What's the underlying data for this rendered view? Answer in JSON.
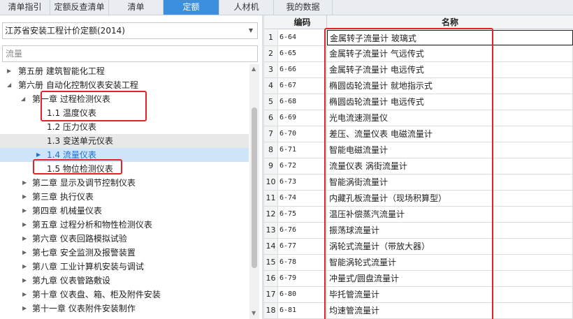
{
  "tabs": [
    {
      "label": "清单指引",
      "active": false
    },
    {
      "label": "定额反查清单",
      "active": false
    },
    {
      "label": "清单",
      "active": false
    },
    {
      "label": "定额",
      "active": true
    },
    {
      "label": "人材机",
      "active": false
    },
    {
      "label": "我的数据",
      "active": false
    }
  ],
  "left": {
    "quota_library": "江苏省安装工程计价定额(2014)",
    "search_placeholder": "流量",
    "tree": [
      {
        "label": "第五册 建筑智能化工程",
        "state": "collapsed"
      },
      {
        "label": "第六册 自动化控制仪表安装工程",
        "state": "expanded"
      },
      {
        "label": "第一章 过程检测仪表",
        "state": "expanded"
      },
      {
        "label": "1.1 温度仪表",
        "state": "leaf"
      },
      {
        "label": "1.2 压力仪表",
        "state": "leaf"
      },
      {
        "label": "1.3 变送单元仪表",
        "state": "leaf"
      },
      {
        "label": "1.4 流量仪表",
        "state": "selected"
      },
      {
        "label": "1.5 物位检测仪表",
        "state": "leaf"
      },
      {
        "label": "第二章 显示及调节控制仪表",
        "state": "collapsed"
      },
      {
        "label": "第三章 执行仪表",
        "state": "collapsed"
      },
      {
        "label": "第四章 机械量仪表",
        "state": "collapsed"
      },
      {
        "label": "第五章 过程分析和物性检测仪表",
        "state": "collapsed"
      },
      {
        "label": "第六章 仪表回路模拟试验",
        "state": "collapsed"
      },
      {
        "label": "第七章 安全监测及报警装置",
        "state": "collapsed"
      },
      {
        "label": "第八章 工业计算机安装与调试",
        "state": "collapsed"
      },
      {
        "label": "第九章 仪表管路敷设",
        "state": "collapsed"
      },
      {
        "label": "第十章 仪表盘、箱、柜及附件安装",
        "state": "collapsed"
      },
      {
        "label": "第十一章 仪表附件安装制作",
        "state": "collapsed"
      }
    ]
  },
  "table": {
    "headers": {
      "code": "编码",
      "name": "名称"
    },
    "rows": [
      {
        "no": "1",
        "code": "6-64",
        "name": "金属转子流量计 玻璃式"
      },
      {
        "no": "2",
        "code": "6-65",
        "name": "金属转子流量计 气远传式"
      },
      {
        "no": "3",
        "code": "6-66",
        "name": "金属转子流量计 电远传式"
      },
      {
        "no": "4",
        "code": "6-67",
        "name": "椭圆齿轮流量计 就地指示式"
      },
      {
        "no": "5",
        "code": "6-68",
        "name": "椭圆齿轮流量计 电远传式"
      },
      {
        "no": "6",
        "code": "6-69",
        "name": "光电流速测量仪"
      },
      {
        "no": "7",
        "code": "6-70",
        "name": "差压、流量仪表 电磁流量计"
      },
      {
        "no": "8",
        "code": "6-71",
        "name": "智能电磁流量计"
      },
      {
        "no": "9",
        "code": "6-72",
        "name": "流量仪表 涡街流量计"
      },
      {
        "no": "10",
        "code": "6-73",
        "name": "智能涡街流量计"
      },
      {
        "no": "11",
        "code": "6-74",
        "name": "内藏孔板流量计（现场积算型）"
      },
      {
        "no": "12",
        "code": "6-75",
        "name": "温压补偿蒸汽流量计"
      },
      {
        "no": "13",
        "code": "6-76",
        "name": "振荡球流量计"
      },
      {
        "no": "14",
        "code": "6-77",
        "name": "涡轮式流量计（带放大器）"
      },
      {
        "no": "15",
        "code": "6-78",
        "name": "智能涡轮式流量计"
      },
      {
        "no": "16",
        "code": "6-79",
        "name": "冲量式/圆盘流量计"
      },
      {
        "no": "17",
        "code": "6-80",
        "name": "毕托管流量计"
      },
      {
        "no": "18",
        "code": "6-81",
        "name": "均速管流量计"
      }
    ]
  },
  "colors": {
    "accent": "#3c8fdc",
    "highlight_box": "#e8202a",
    "selected_row": "#cde4f9"
  }
}
